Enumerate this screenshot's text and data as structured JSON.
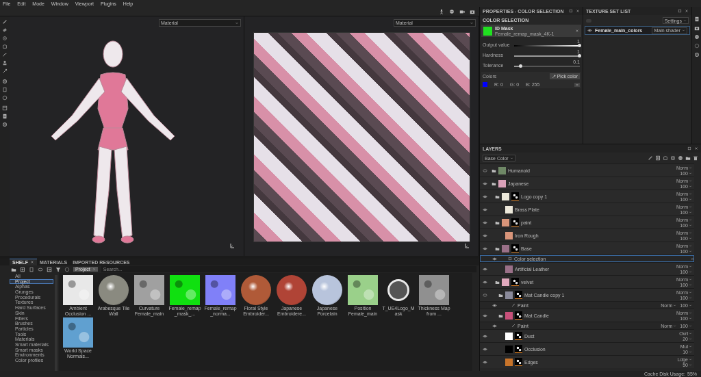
{
  "menu": [
    "File",
    "Edit",
    "Mode",
    "Window",
    "Viewport",
    "Plugins",
    "Help"
  ],
  "viewports": [
    {
      "kind": "model",
      "mode": "Material"
    },
    {
      "kind": "uv",
      "mode": "Material"
    }
  ],
  "properties": {
    "title": "PROPERTIES - COLOR SELECTION",
    "section": "COLOR SELECTION",
    "mask": {
      "name": "ID Mask",
      "file": "Female_remap_mask_4K-1"
    },
    "sliders": [
      {
        "label": "Output value",
        "reading": "1",
        "level": 1,
        "kind": "gradient"
      },
      {
        "label": "Hardness",
        "reading": "1",
        "level": 1,
        "kind": "plain"
      },
      {
        "label": "Tolerance",
        "reading": "0.1",
        "level": 0.1,
        "kind": "plain"
      }
    ],
    "colors_label": "Colors",
    "pick_button": "Pick color",
    "colors": [
      {
        "color": "#0000ff",
        "r": "R: 0",
        "g": "G: 0",
        "b": "B: 255"
      }
    ]
  },
  "texture_set_list": {
    "title": "TEXTURE SET LIST",
    "settings": "Settings",
    "sets": [
      {
        "name": "Female_main_colors",
        "shader": "Main shader",
        "visible": true,
        "selected": true
      }
    ]
  },
  "layers": {
    "title": "LAYERS",
    "channel": "Base Color",
    "items": [
      {
        "name": "Humanoid",
        "kind": "folder",
        "visible": false,
        "selected": false,
        "color": "#6f8866",
        "mask": false,
        "blend": "Norm",
        "opacity": "100"
      },
      {
        "name": "Japanese",
        "kind": "folder",
        "visible": true,
        "selected": false,
        "color": "#d9a0b8",
        "mask": false,
        "blend": "Norm",
        "opacity": "100",
        "children": [
          {
            "name": "Logo copy 1",
            "kind": "folder",
            "visible": true,
            "selected": false,
            "color": "#ece8da",
            "mask": true,
            "blend": "Norm",
            "opacity": "100",
            "children": [
              {
                "name": "Brass Plate",
                "kind": "layer",
                "visible": true,
                "selected": false,
                "color": "#ece8da",
                "mask": false,
                "blend": "Norm",
                "opacity": "100"
              }
            ]
          },
          {
            "name": "paint",
            "kind": "folder",
            "visible": true,
            "selected": false,
            "color": "#d9957a",
            "mask": true,
            "blend": "Norm",
            "opacity": "100",
            "children": [
              {
                "name": "Iron Rough",
                "kind": "layer",
                "visible": true,
                "selected": false,
                "color": "#d9957a",
                "mask": false,
                "blend": "Norm",
                "opacity": "100"
              }
            ]
          },
          {
            "name": "Base",
            "kind": "folder",
            "visible": true,
            "selected": false,
            "color": "#9a7088",
            "mask": true,
            "blend": "Norm",
            "opacity": "100",
            "children": [
              {
                "name": "Color selection",
                "kind": "selection",
                "visible": true,
                "selected": true
              },
              {
                "name": "Artificial Leather",
                "kind": "layer",
                "visible": true,
                "selected": false,
                "color": "#9a7088",
                "mask": false,
                "blend": "Norm",
                "opacity": "100"
              }
            ]
          },
          {
            "name": "velvet",
            "kind": "folder",
            "visible": true,
            "selected": false,
            "color": "#e0a8bc",
            "mask": true,
            "blend": "Norm",
            "opacity": "100",
            "children": [
              {
                "name": "Mat Candle copy 1",
                "kind": "folder",
                "visible": false,
                "selected": false,
                "color": "#8a8a9a",
                "mask": true,
                "blend": "Norm",
                "opacity": "100",
                "children": [
                  {
                    "name": "Paint",
                    "kind": "paint",
                    "visible": true,
                    "selected": false,
                    "blend": "Norm",
                    "opacity": "100"
                  }
                ]
              },
              {
                "name": "Mat Candle",
                "kind": "folder",
                "visible": true,
                "selected": false,
                "color": "#c8507a",
                "mask": true,
                "blend": "Norm",
                "opacity": "100",
                "children": [
                  {
                    "name": "Paint",
                    "kind": "paint",
                    "visible": true,
                    "selected": false,
                    "blend": "Norm",
                    "opacity": "100"
                  }
                ]
              },
              {
                "name": "Dust",
                "kind": "layer",
                "visible": true,
                "selected": false,
                "color": "#ffffff",
                "mask": true,
                "blend": "Ovrl",
                "opacity": "20"
              },
              {
                "name": "Occlusion",
                "kind": "layer",
                "visible": true,
                "selected": false,
                "color": "#000000",
                "mask": true,
                "blend": "Mul",
                "opacity": "10"
              },
              {
                "name": "Edges",
                "kind": "layer",
                "visible": true,
                "selected": false,
                "color": "#c8742a",
                "mask": true,
                "blend": "Ldge",
                "opacity": "50"
              }
            ]
          }
        ]
      }
    ]
  },
  "shelf": {
    "tabs": [
      {
        "label": "SHELF",
        "selected": true,
        "closable": true
      },
      {
        "label": "MATERIALS",
        "selected": false,
        "closable": false
      },
      {
        "label": "IMPORTED RESOURCES",
        "selected": false,
        "closable": false
      }
    ],
    "filter": "Project",
    "search_placeholder": "Search...",
    "categories": [
      {
        "label": "All",
        "selected": false
      },
      {
        "label": "Project",
        "selected": true
      },
      {
        "label": "Alphas",
        "selected": false
      },
      {
        "label": "Grunges",
        "selected": false
      },
      {
        "label": "Procedurals",
        "selected": false
      },
      {
        "label": "Textures",
        "selected": false
      },
      {
        "label": "Hard Surfaces",
        "selected": false
      },
      {
        "label": "Skin",
        "selected": false
      },
      {
        "label": "Filters",
        "selected": false
      },
      {
        "label": "Brushes",
        "selected": false
      },
      {
        "label": "Particles",
        "selected": false
      },
      {
        "label": "Tools",
        "selected": false
      },
      {
        "label": "Materials",
        "selected": false
      },
      {
        "label": "Smart materials",
        "selected": false
      },
      {
        "label": "Smart masks",
        "selected": false
      },
      {
        "label": "Environments",
        "selected": false
      },
      {
        "label": "Color profiles",
        "selected": false
      }
    ],
    "assets": [
      {
        "name": "Ambient Occlusion ...",
        "kind": "texture",
        "color": "#e8e8e8"
      },
      {
        "name": "Arabesque Tile Wall",
        "kind": "sphere",
        "color": "#8a8a80"
      },
      {
        "name": "Curvature Female_main",
        "kind": "texture",
        "color": "#a0a0a0"
      },
      {
        "name": "Female_remap_mask_...",
        "kind": "texture",
        "color": "#10e010"
      },
      {
        "name": "Female_remap_norma...",
        "kind": "texture",
        "color": "#8080f8"
      },
      {
        "name": "Floral Style Embroider...",
        "kind": "sphere",
        "color": "#b05a38"
      },
      {
        "name": "Japanese Embroidere...",
        "kind": "sphere",
        "color": "#b04436"
      },
      {
        "name": "Japanese Porcelain",
        "kind": "sphere",
        "color": "#b8c4dc"
      },
      {
        "name": "Position Female_main",
        "kind": "texture",
        "color": "#9ad08a"
      },
      {
        "name": "T_UE4Logo_Mask",
        "kind": "logo",
        "color": "#e8e8e8"
      },
      {
        "name": "Thickness Map from ...",
        "kind": "texture",
        "color": "#909090"
      },
      {
        "name": "World Space Normals...",
        "kind": "texture",
        "color": "#60a0d0"
      }
    ]
  },
  "status_bar": {
    "label": "Cache Disk Usage:",
    "value": "55%"
  }
}
